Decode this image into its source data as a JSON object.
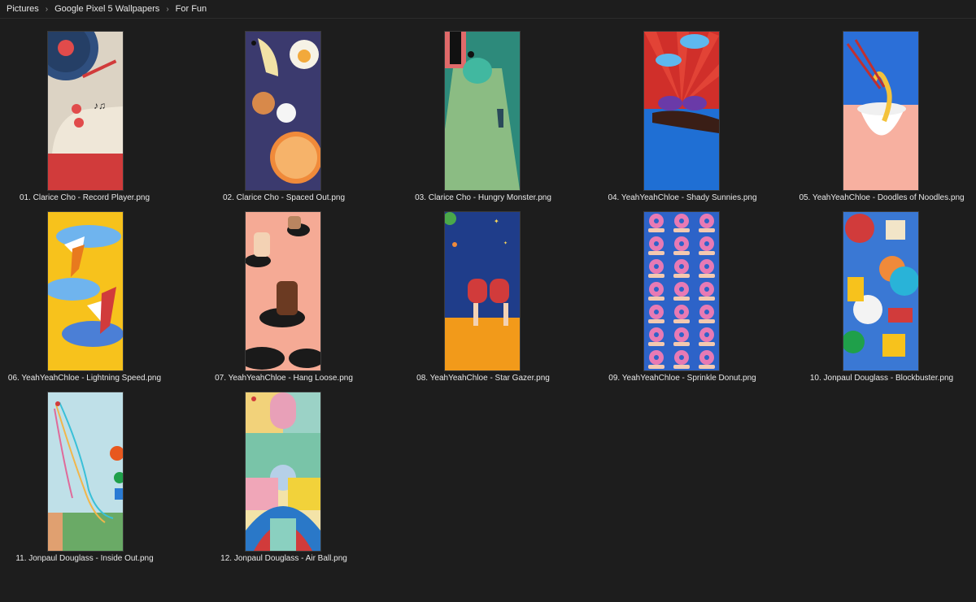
{
  "breadcrumb": [
    "Pictures",
    "Google Pixel 5 Wallpapers",
    "For Fun"
  ],
  "separator_icon": "chevron-right-icon",
  "colors": {
    "background": "#1d1d1d",
    "text": "#e8e8e8"
  },
  "files": [
    {
      "name": "01. Clarice Cho - Record Player.png",
      "art": "record-player"
    },
    {
      "name": "02. Clarice Cho - Spaced Out.png",
      "art": "spaced-out"
    },
    {
      "name": "03. Clarice Cho - Hungry Monster.png",
      "art": "hungry-monster"
    },
    {
      "name": "04. YeahYeahChloe - Shady Sunnies.png",
      "art": "shady-sunnies"
    },
    {
      "name": "05. YeahYeahChloe - Doodles of Noodles.png",
      "art": "doodles-of-noodles"
    },
    {
      "name": "06. YeahYeahChloe - Lightning Speed.png",
      "art": "lightning-speed"
    },
    {
      "name": "07. YeahYeahChloe - Hang Loose.png",
      "art": "hang-loose"
    },
    {
      "name": "08. YeahYeahChloe - Star Gazer.png",
      "art": "star-gazer"
    },
    {
      "name": "09. YeahYeahChloe - Sprinkle Donut.png",
      "art": "sprinkle-donut"
    },
    {
      "name": "10. Jonpaul Douglass - Blockbuster.png",
      "art": "blockbuster"
    },
    {
      "name": "11. Jonpaul Douglass - Inside Out.png",
      "art": "inside-out"
    },
    {
      "name": "12. Jonpaul Douglass - Air Ball.png",
      "art": "air-ball"
    }
  ]
}
